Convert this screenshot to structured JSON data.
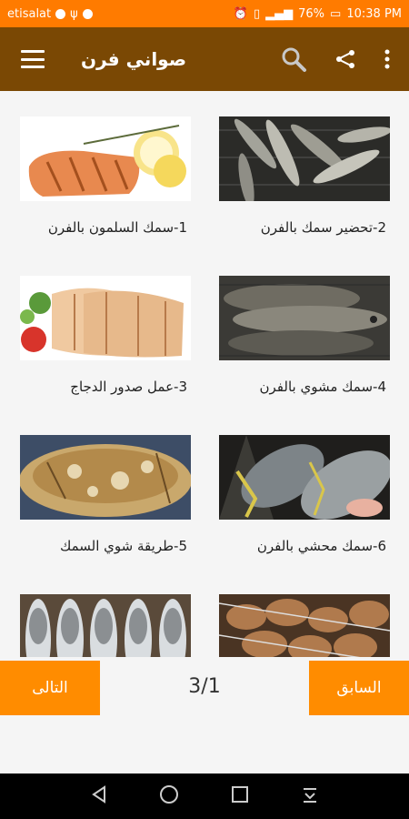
{
  "status_bar": {
    "carrier": "etisalat",
    "battery": "76%",
    "time": "10:38 PM",
    "network": "4G"
  },
  "app_bar": {
    "title": "صواني فرن",
    "menu_icon": "menu-icon",
    "search_icon": "search-icon",
    "share_icon": "share-icon",
    "more_icon": "more-vert-icon"
  },
  "recipes": [
    {
      "label": "2-تحضير سمك بالفرن",
      "image": "sardines-on-grill"
    },
    {
      "label": "1-سمك السلمون بالفرن",
      "image": "salmon-fillet"
    },
    {
      "label": "4-سمك مشوي بالفرن",
      "image": "grilled-whole-fish"
    },
    {
      "label": "3-عمل صدور الدجاج",
      "image": "sliced-chicken-breast"
    },
    {
      "label": "6-سمك محشي بالفرن",
      "image": "stuffed-fish"
    },
    {
      "label": "5-طريقة شوي السمك",
      "image": "grilled-fish-platter"
    },
    {
      "label": "",
      "image": "skewered-meat"
    },
    {
      "label": "",
      "image": "whole-fish-row"
    }
  ],
  "pagination": {
    "next_label": "التالى",
    "prev_label": "السابق",
    "page_text": "3/1"
  },
  "colors": {
    "status_bar": "#ff7b00",
    "app_bar": "#7a4804",
    "button": "#ff8c00"
  }
}
